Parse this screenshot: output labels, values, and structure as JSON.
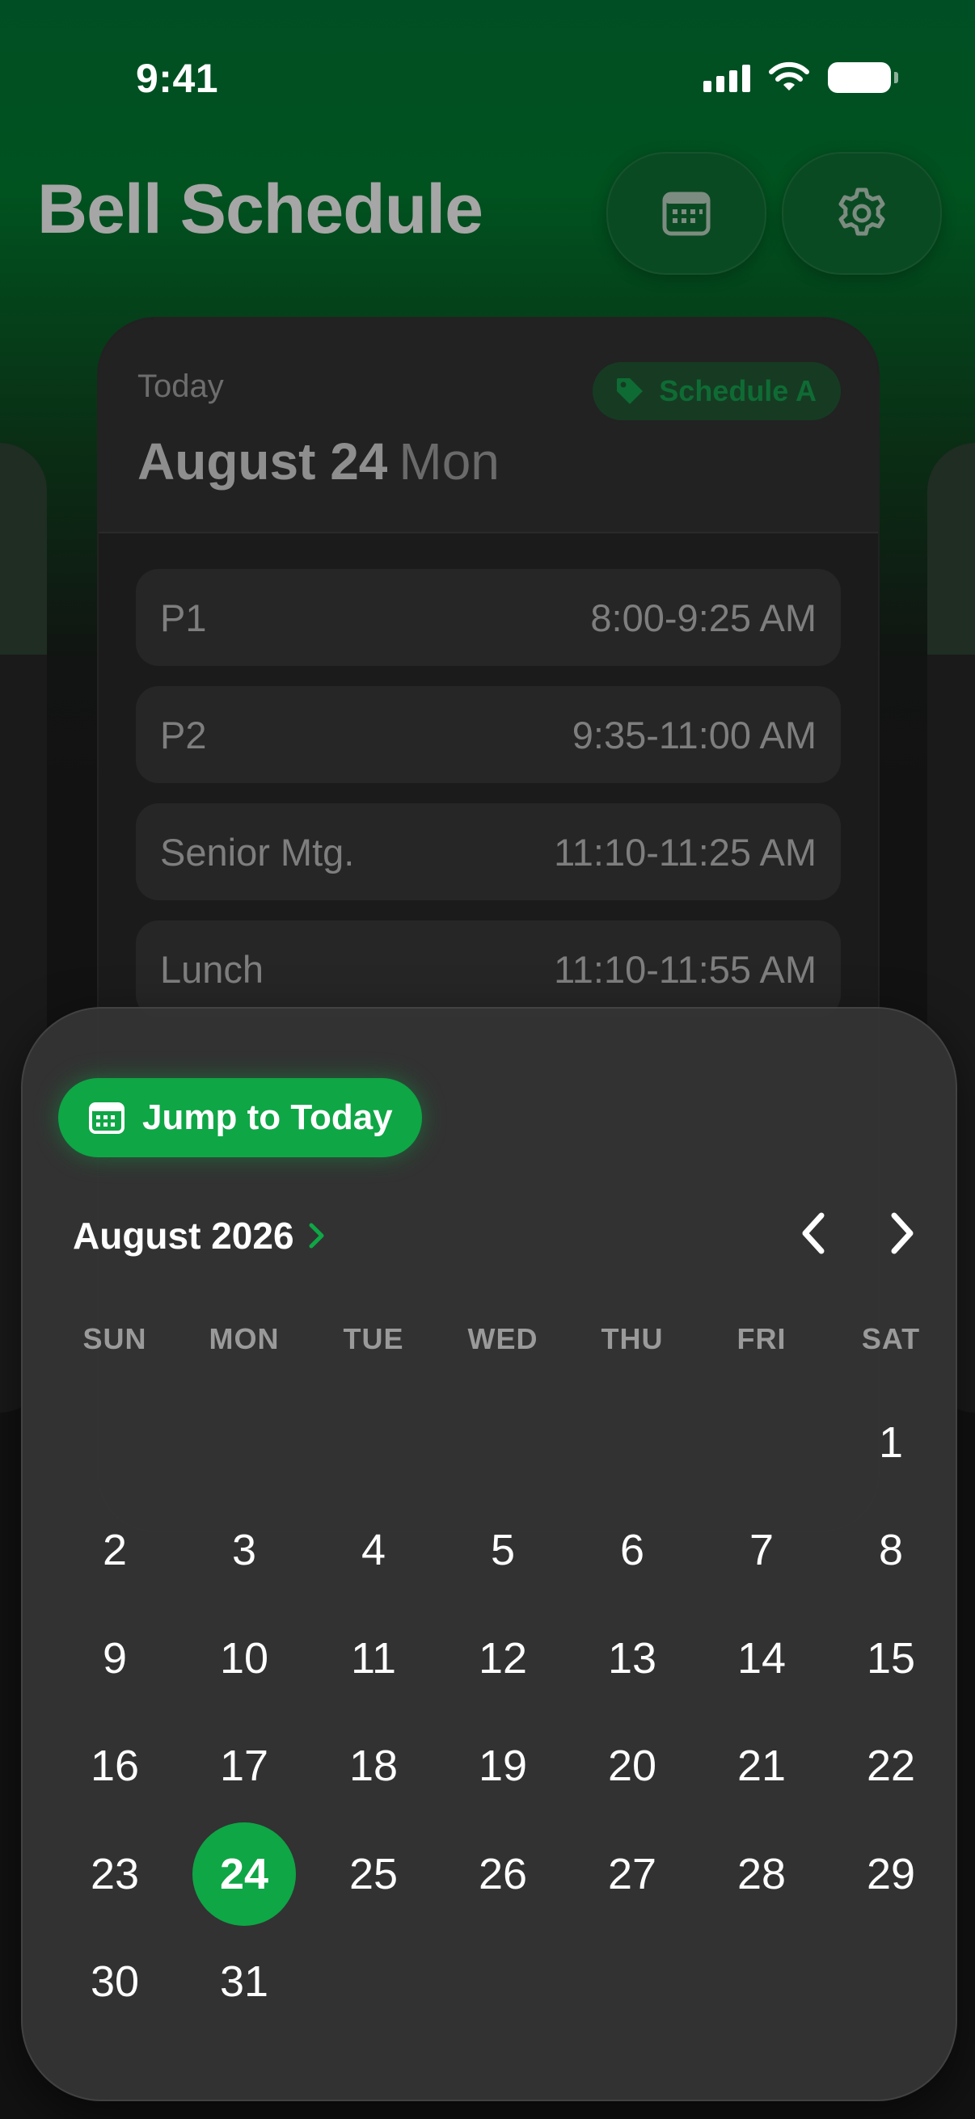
{
  "status_bar": {
    "time": "9:41"
  },
  "header": {
    "title": "Bell Schedule"
  },
  "schedule_card": {
    "today_label": "Today",
    "date": "August 24",
    "weekday": "Mon",
    "badge": "Schedule A",
    "periods": [
      {
        "name": "P1",
        "time": "8:00-9:25 AM"
      },
      {
        "name": "P2",
        "time": "9:35-11:00 AM"
      },
      {
        "name": "Senior Mtg.",
        "time": "11:10-11:25 AM"
      },
      {
        "name": "Lunch",
        "time": "11:10-11:55 AM"
      }
    ]
  },
  "calendar": {
    "jump_label": "Jump to Today",
    "month_title": "August 2026",
    "weekdays": [
      "SUN",
      "MON",
      "TUE",
      "WED",
      "THU",
      "FRI",
      "SAT"
    ],
    "leading_blanks": 6,
    "days_in_month": 31,
    "selected_day": 24,
    "accent_color": "#0fa646"
  },
  "colors": {
    "header_green": "#004f24",
    "accent": "#0fa646"
  }
}
